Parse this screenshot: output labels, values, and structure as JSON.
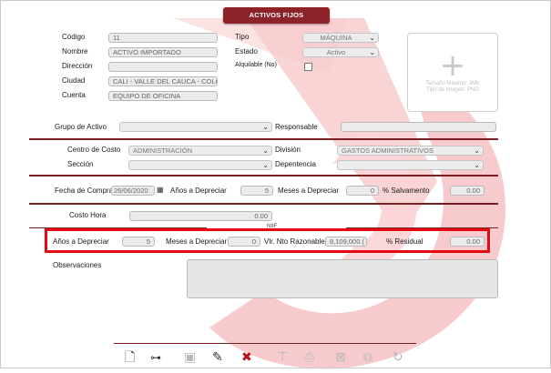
{
  "title": "ACTIVOS FIJOS",
  "fields": {
    "codigo_label": "Código",
    "codigo_value": "11",
    "nombre_label": "Nombre",
    "nombre_value": "ACTIVO IMPORTADO",
    "direccion_label": "Dirección",
    "direccion_value": "",
    "ciudad_label": "Ciudad",
    "ciudad_value": "CALI - VALLE DEL CAUCA - COLO",
    "cuenta_label": "Cuenta",
    "cuenta_value": "EQUIPO DE OFICINA",
    "tipo_label": "Tipo",
    "tipo_value": "MÁQUINA",
    "estado_label": "Estado",
    "estado_value": "Activo",
    "alquilable_label": "Alquilable (No)",
    "grupo_label": "Grupo de Activo",
    "grupo_value": "",
    "responsable_label": "Responsable",
    "responsable_value": "",
    "centro_label": "Centro de Costo",
    "centro_value": "ADMINISTRACIÓN",
    "division_label": "División",
    "division_value": "GASTOS ADMINISTRATIVOS",
    "seccion_label": "Sección",
    "seccion_value": "",
    "dependencia_label": "Depentencia",
    "dependencia_value": "",
    "fecha_label": "Fecha de Compra",
    "fecha_value": "26/06/2020",
    "anos_label": "Años a Depreciar",
    "anos_value": "5",
    "meses_label": "Meses a Depreciar",
    "meses_value": "0",
    "salvamento_label": "% Salvamento",
    "salvamento_value": "0.00",
    "costo_label": "Costo Hora",
    "costo_value": "0.00",
    "nif_label": "NIIF",
    "nif_anos_label": "Años a Depreciar",
    "nif_anos_value": "5",
    "nif_meses_label": "Meses a Depreciar",
    "nif_meses_value": "0",
    "vlr_label": "Vlr. Nto Razonable",
    "vlr_value": "8,109,000.(",
    "residual_label": "% Residual",
    "residual_value": "0.00",
    "observaciones_label": "Observaciones",
    "observaciones_value": ""
  },
  "photo": {
    "caption_line1": "Tamaño Máximo: 3Mb",
    "caption_line2": "Tipo de Imagen: PNG"
  },
  "icons": [
    "new-document-icon",
    "binoculars-search-icon",
    "save-icon",
    "edit-pencil-icon",
    "delete-x-icon",
    "text-icon",
    "print-icon",
    "excel-export-icon",
    "copy-icon",
    "history-icon"
  ],
  "colors": {
    "accent": "#8d2328",
    "highlight": "#e50914"
  }
}
